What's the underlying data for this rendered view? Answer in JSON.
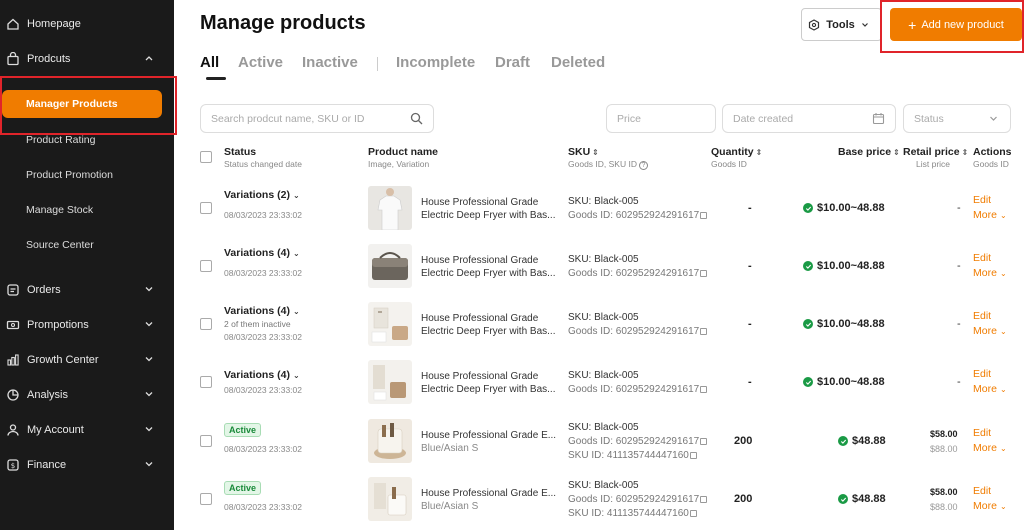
{
  "sidebar": {
    "items": [
      {
        "label": "Homepage",
        "icon": "home-icon"
      },
      {
        "label": "Prodcuts",
        "icon": "bag-icon"
      },
      {
        "label": "Orders",
        "icon": "orders-icon"
      },
      {
        "label": "Prompotions",
        "icon": "promotions-icon"
      },
      {
        "label": "Growth Center",
        "icon": "growth-icon"
      },
      {
        "label": "Analysis",
        "icon": "analysis-icon"
      },
      {
        "label": "My Account",
        "icon": "account-icon"
      },
      {
        "label": "Finance",
        "icon": "finance-icon"
      }
    ],
    "sub_items": [
      "Manager Products",
      "Product Rating",
      "Product Promotion",
      "Manage Stock",
      "Source Center"
    ]
  },
  "header": {
    "title": "Manage products",
    "tools_label": "Tools",
    "add_label": "Add new product"
  },
  "tabs": [
    "All",
    "Active",
    "Inactive",
    "Incomplete",
    "Draft",
    "Deleted"
  ],
  "filters": {
    "search_placeholder": "Search prodcut name, SKU or ID",
    "price_placeholder": "Price",
    "date_placeholder": "Date  created",
    "status_placeholder": "Status"
  },
  "columns": {
    "status": "Status",
    "status_sub": "Status changed date",
    "product": "Product name",
    "product_sub": "Image, Variation",
    "sku": "SKU",
    "sku_sub": "Goods ID, SKU ID",
    "qty": "Quantity",
    "qty_sub": "Goods ID",
    "base": "Base price",
    "retail": "Retail price",
    "retail_sub": "List price",
    "actions": "Actions",
    "actions_sub": "Goods ID"
  },
  "rows": [
    {
      "status": "Variations (2)",
      "date": "08/03/2023 23:33:02",
      "name1": "House Professional Grade",
      "name2": "Electric Deep Fryer with Bas...",
      "sku": "SKU: Black-005",
      "gid": "Goods ID: 602952924291617",
      "qty": "-",
      "base": "$10.00~48.88",
      "retail": "-",
      "edit": "Edit",
      "more": "More"
    },
    {
      "status": "Variations (4)",
      "date": "08/03/2023 23:33:02",
      "name1": "House Professional Grade",
      "name2": "Electric Deep Fryer with Bas...",
      "sku": "SKU: Black-005",
      "gid": "Goods ID: 602952924291617",
      "qty": "-",
      "base": "$10.00~48.88",
      "retail": "-",
      "edit": "Edit",
      "more": "More"
    },
    {
      "status": "Variations (4)",
      "note": "2 of them inactive",
      "date": "08/03/2023 23:33:02",
      "name1": "House Professional Grade",
      "name2": "Electric Deep Fryer with Bas...",
      "sku": "SKU: Black-005",
      "gid": "Goods ID: 602952924291617",
      "qty": "-",
      "base": "$10.00~48.88",
      "retail": "-",
      "edit": "Edit",
      "more": "More"
    },
    {
      "status": "Variations (4)",
      "date": "08/03/2023 23:33:02",
      "name1": "House Professional Grade",
      "name2": "Electric Deep Fryer with Bas...",
      "sku": "SKU: Black-005",
      "gid": "Goods ID: 602952924291617",
      "qty": "-",
      "base": "$10.00~48.88",
      "retail": "-",
      "edit": "Edit",
      "more": "More"
    },
    {
      "badge": "Active",
      "date": "08/03/2023 23:33:02",
      "name1": "House Professional Grade E...",
      "name2": "Blue/Asian S",
      "sku": "SKU: Black-005",
      "gid": "Goods ID: 602952924291617",
      "skuid": "SKU ID: 411135744447160",
      "qty": "200",
      "base": "$48.88",
      "retail1": "$58.00",
      "retail2": "$88.00",
      "edit": "Edit",
      "more": "More"
    },
    {
      "badge": "Active",
      "date": "08/03/2023 23:33:02",
      "name1": "House Professional Grade E...",
      "name2": "Blue/Asian S",
      "sku": "SKU: Black-005",
      "gid": "Goods ID: 602952924291617",
      "skuid": "SKU ID: 411135744447160",
      "qty": "200",
      "base": "$48.88",
      "retail1": "$58.00",
      "retail2": "$88.00",
      "edit": "Edit",
      "more": "More"
    }
  ]
}
